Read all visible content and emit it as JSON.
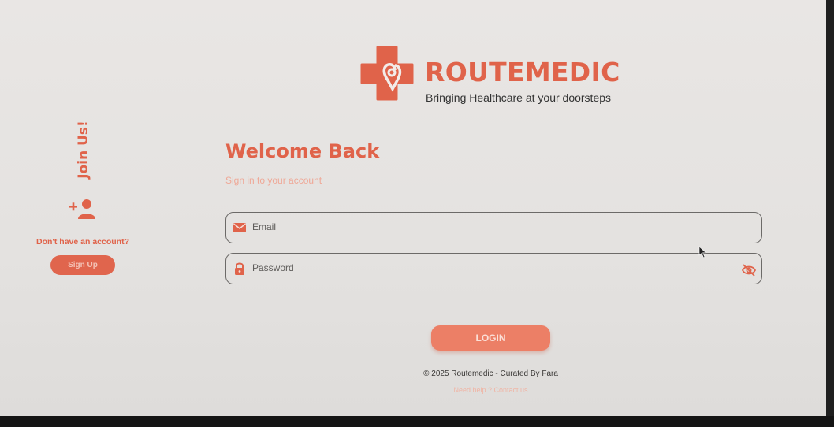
{
  "brand": {
    "name": "ROUTEMEDIC",
    "tagline": "Bringing Healthcare at your doorsteps",
    "logo_icon": "medical-cross-location-pin"
  },
  "left_panel": {
    "join_label": "Join Us!",
    "join_icon": "add-user-icon",
    "no_account_text": "Don't have an account?",
    "signup_label": "Sign Up"
  },
  "form": {
    "title": "Welcome Back",
    "subtitle": "Sign in to your account",
    "email": {
      "placeholder": "Email",
      "icon": "mail-icon"
    },
    "password": {
      "placeholder": "Password",
      "icon": "lock-icon",
      "toggle_icon": "eye-off-icon"
    },
    "login_label": "LOGIN"
  },
  "footer": {
    "copyright": "© 2025 Routemedic - Curated By Fara",
    "help_link": "Need help ? Contact us"
  },
  "colors": {
    "brand": "#e0634a",
    "button": "#ec7f66",
    "background": "#e6e4e2"
  }
}
